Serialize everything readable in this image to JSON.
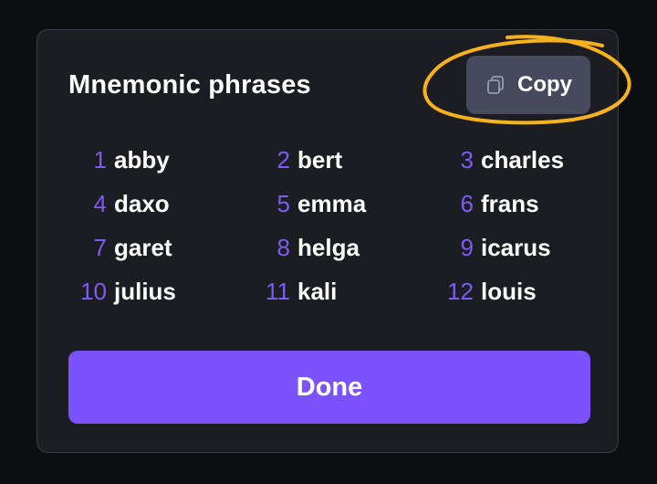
{
  "dialog": {
    "title": "Mnemonic phrases",
    "copy_label": "Copy",
    "done_label": "Done"
  },
  "words": [
    {
      "index": "1",
      "word": "abby"
    },
    {
      "index": "2",
      "word": "bert"
    },
    {
      "index": "3",
      "word": "charles"
    },
    {
      "index": "4",
      "word": "daxo"
    },
    {
      "index": "5",
      "word": "emma"
    },
    {
      "index": "6",
      "word": "frans"
    },
    {
      "index": "7",
      "word": "garet"
    },
    {
      "index": "8",
      "word": "helga"
    },
    {
      "index": "9",
      "word": "icarus"
    },
    {
      "index": "10",
      "word": "julius"
    },
    {
      "index": "11",
      "word": "kali"
    },
    {
      "index": "12",
      "word": "louis"
    }
  ],
  "icons": {
    "copy": "copy-icon"
  },
  "colors": {
    "background": "#0d0e11",
    "card": "#1c1d23",
    "accent": "#7b52fb",
    "index": "#7c5cf2",
    "copy_button": "#474a5c",
    "annotation": "#f5b21b"
  }
}
